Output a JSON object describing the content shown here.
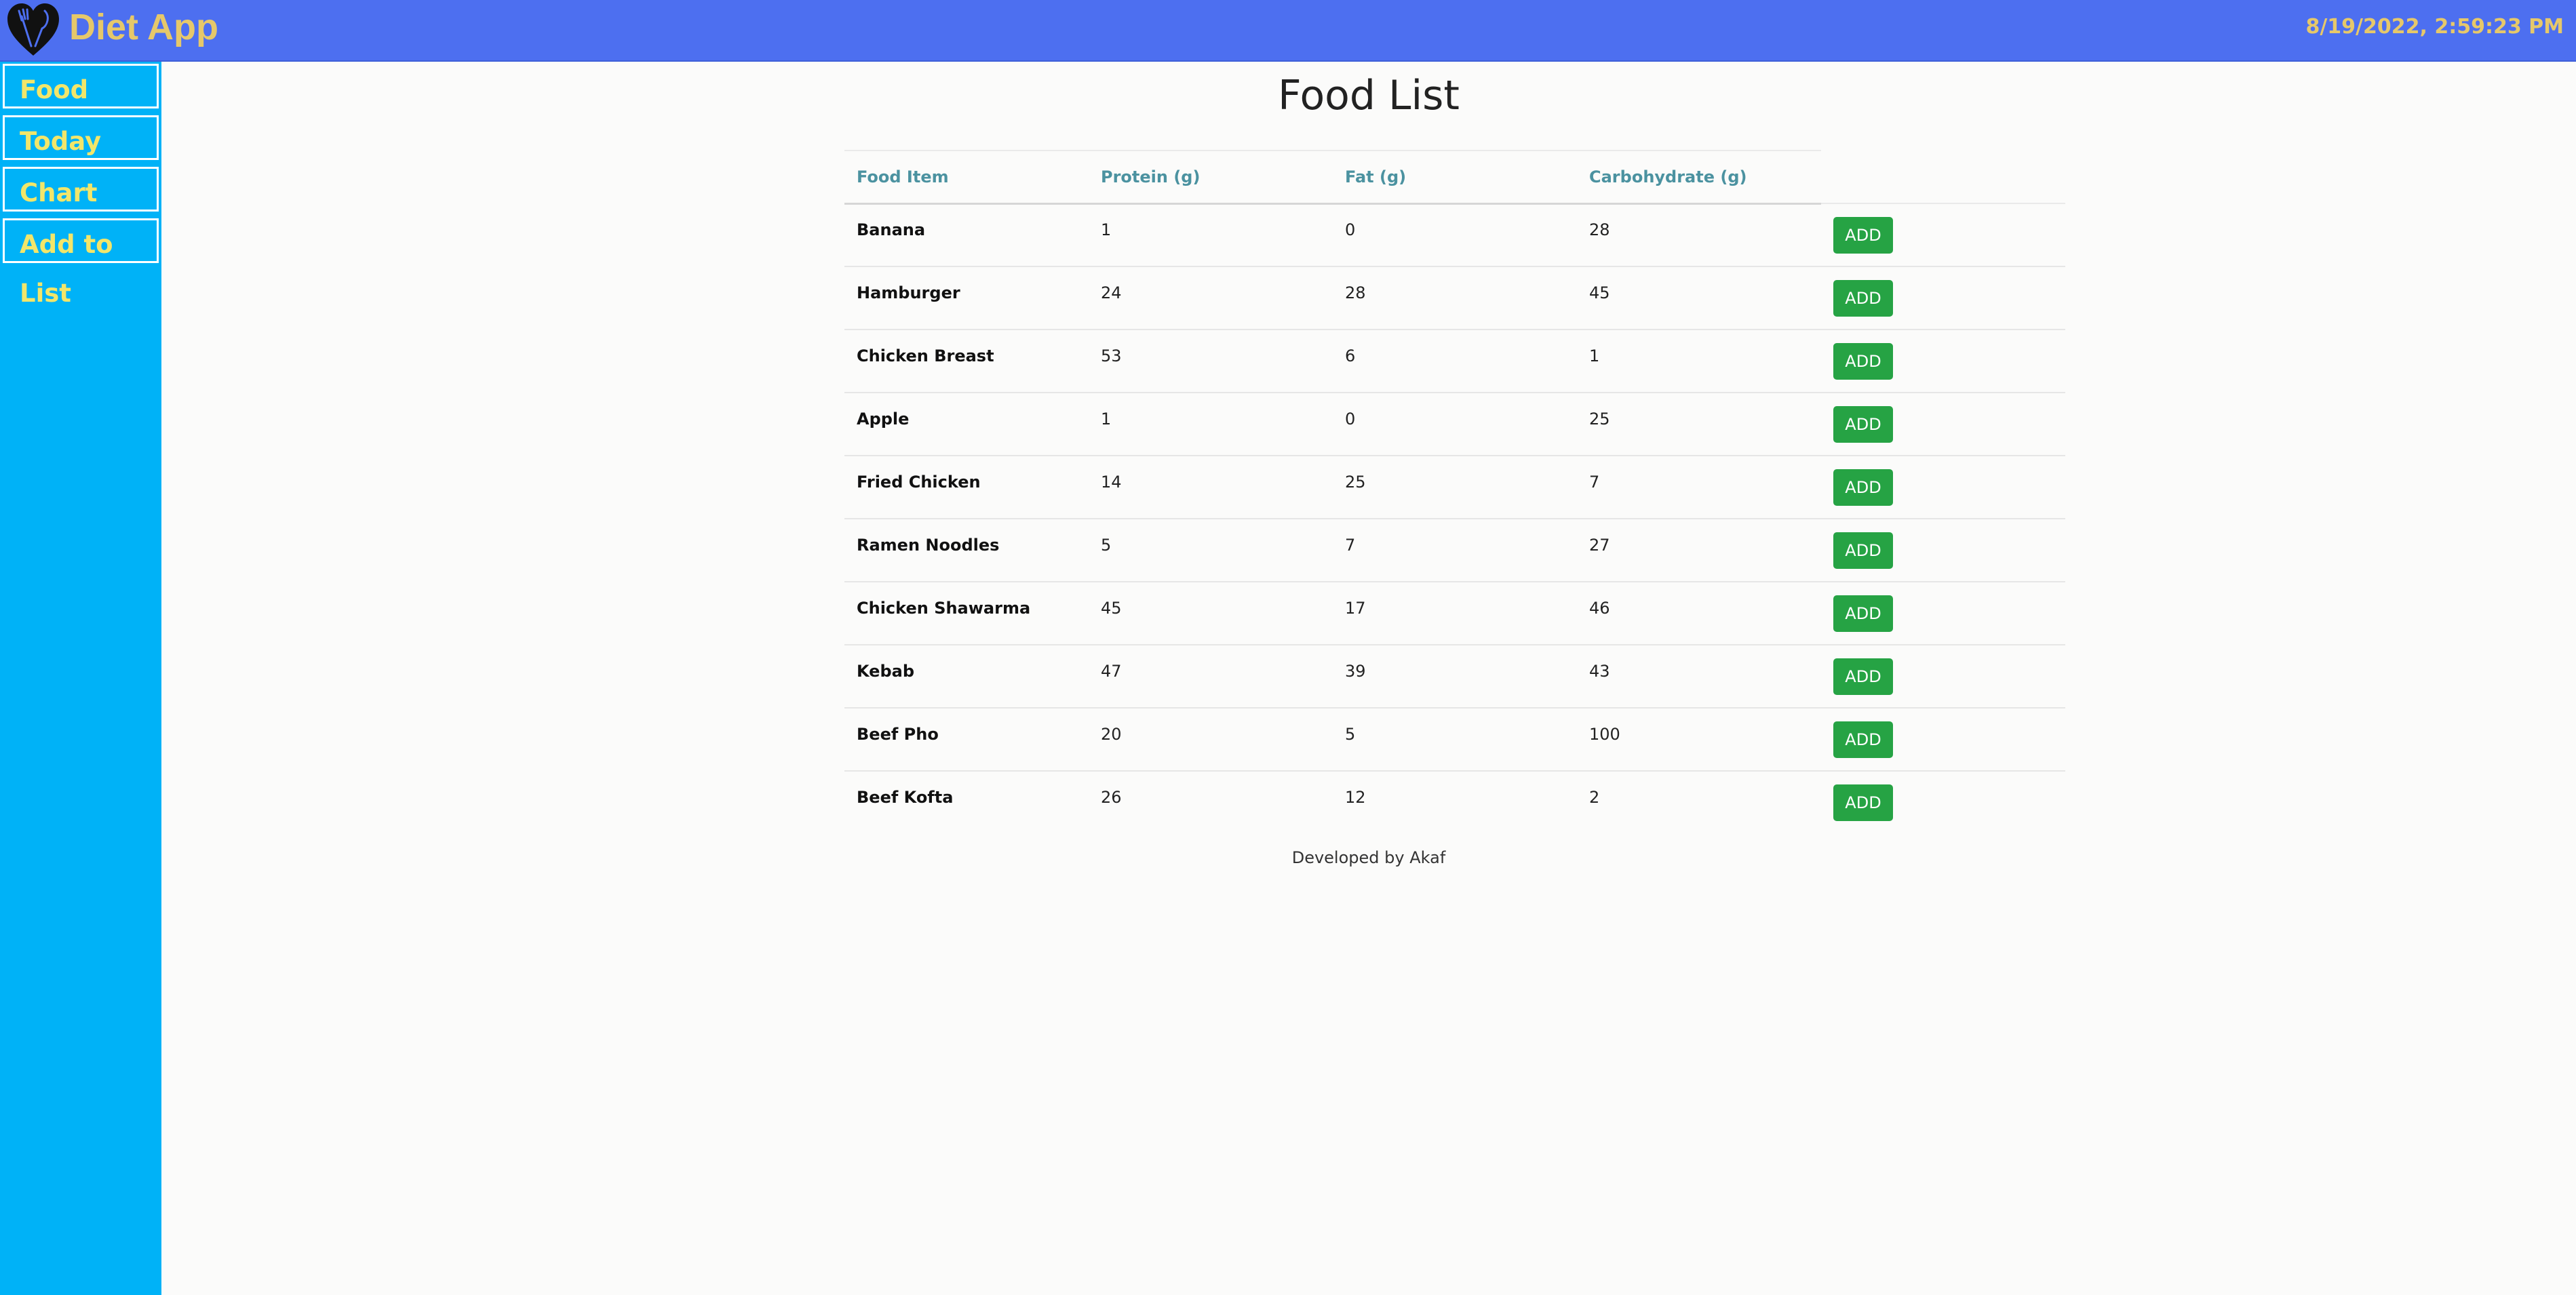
{
  "header": {
    "app_title": "Diet App",
    "datetime": "8/19/2022, 2:59:23 PM",
    "logo_icon": "heart-fork-knife-icon"
  },
  "sidebar": {
    "items": [
      {
        "label": "Food"
      },
      {
        "label": "Today"
      },
      {
        "label": "Chart"
      },
      {
        "label": "Add to List"
      }
    ]
  },
  "main": {
    "title": "Food List",
    "table": {
      "columns": [
        "Food Item",
        "Protein (g)",
        "Fat (g)",
        "Carbohydrate (g)"
      ],
      "action_label": "ADD",
      "rows": [
        {
          "name": "Banana",
          "protein": "1",
          "fat": "0",
          "carbs": "28"
        },
        {
          "name": "Hamburger",
          "protein": "24",
          "fat": "28",
          "carbs": "45"
        },
        {
          "name": "Chicken Breast",
          "protein": "53",
          "fat": "6",
          "carbs": "1"
        },
        {
          "name": "Apple",
          "protein": "1",
          "fat": "0",
          "carbs": "25"
        },
        {
          "name": "Fried Chicken",
          "protein": "14",
          "fat": "25",
          "carbs": "7"
        },
        {
          "name": "Ramen Noodles",
          "protein": "5",
          "fat": "7",
          "carbs": "27"
        },
        {
          "name": "Chicken Shawarma",
          "protein": "45",
          "fat": "17",
          "carbs": "46"
        },
        {
          "name": "Kebab",
          "protein": "47",
          "fat": "39",
          "carbs": "43"
        },
        {
          "name": "Beef Pho",
          "protein": "20",
          "fat": "5",
          "carbs": "100"
        },
        {
          "name": "Beef Kofta",
          "protein": "26",
          "fat": "12",
          "carbs": "2"
        }
      ]
    },
    "footer": "Developed by Akaf"
  },
  "colors": {
    "topbar": "#4d6ff0",
    "sidebar": "#00b2f7",
    "title_gold": "#e6c86a",
    "nav_text": "#f2e66a",
    "header_text": "#4b92a0",
    "add_button": "#26a344"
  }
}
